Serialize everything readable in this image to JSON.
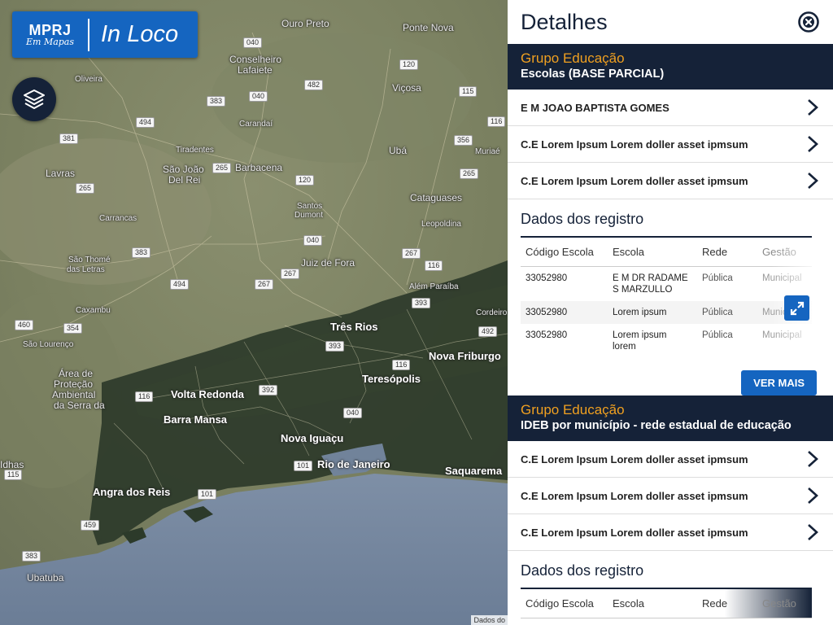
{
  "map": {
    "brand": {
      "mprj": "MPRJ",
      "subtitle": "Em Mapas",
      "product": "In Loco"
    },
    "layers_icon": "layers-icon",
    "attribution": "Dados do",
    "cities": [
      {
        "name": "Ouro Preto",
        "cls": ""
      },
      {
        "name": "Ponte Nova",
        "cls": ""
      },
      {
        "name": "Conselheiro",
        "cls": ""
      },
      {
        "name": "Lafaiete",
        "cls": ""
      },
      {
        "name": "Viçosa",
        "cls": ""
      },
      {
        "name": "Oliveira",
        "cls": "small"
      },
      {
        "name": "Carandaí",
        "cls": "small"
      },
      {
        "name": "Ubá",
        "cls": ""
      },
      {
        "name": "Muriaé",
        "cls": "small"
      },
      {
        "name": "Tiradentes",
        "cls": "small"
      },
      {
        "name": "São João",
        "cls": ""
      },
      {
        "name": "Del Rei",
        "cls": ""
      },
      {
        "name": "Barbacena",
        "cls": ""
      },
      {
        "name": "Lavras",
        "cls": ""
      },
      {
        "name": "Cataguases",
        "cls": ""
      },
      {
        "name": "Santos",
        "cls": "small"
      },
      {
        "name": "Dumont",
        "cls": "small"
      },
      {
        "name": "Carrancas",
        "cls": "small"
      },
      {
        "name": "Leopoldina",
        "cls": "small"
      },
      {
        "name": "Juiz de Fora",
        "cls": ""
      },
      {
        "name": "São Thomé",
        "cls": "small"
      },
      {
        "name": "das Letras",
        "cls": "small"
      },
      {
        "name": "Além Paraíba",
        "cls": "small"
      },
      {
        "name": "Caxambu",
        "cls": "small"
      },
      {
        "name": "Cordeiro",
        "cls": "small"
      },
      {
        "name": "São Lourenço",
        "cls": "small"
      },
      {
        "name": "Três Rios",
        "cls": "big"
      },
      {
        "name": "Nova Friburgo",
        "cls": "big"
      },
      {
        "name": "Teresópolis",
        "cls": "big"
      },
      {
        "name": "Área de",
        "cls": ""
      },
      {
        "name": "Proteção",
        "cls": ""
      },
      {
        "name": "Ambiental",
        "cls": ""
      },
      {
        "name": "da Serra da",
        "cls": ""
      },
      {
        "name": "Volta Redonda",
        "cls": "big"
      },
      {
        "name": "Barra Mansa",
        "cls": "big"
      },
      {
        "name": "Nova Iguaçu",
        "cls": "big"
      },
      {
        "name": "Rio de Janeiro",
        "cls": "big"
      },
      {
        "name": "Saquarema",
        "cls": "big"
      },
      {
        "name": "Angra dos Reis",
        "cls": "big"
      },
      {
        "name": "Ubatuba",
        "cls": ""
      },
      {
        "name": "Idhas",
        "cls": ""
      }
    ],
    "shields": [
      "040",
      "120",
      "482",
      "040",
      "383",
      "494",
      "116",
      "381",
      "356",
      "265",
      "265",
      "265",
      "120",
      "115",
      "383",
      "040",
      "267",
      "494",
      "267",
      "116",
      "267",
      "354",
      "460",
      "393",
      "492",
      "393",
      "116",
      "040",
      "392",
      "101",
      "101",
      "459",
      "383",
      "115",
      "116"
    ]
  },
  "panel": {
    "title": "Detalhes",
    "close_icon": "close-circle-icon",
    "groups": [
      {
        "name": "Grupo Educação",
        "layer": "Escolas (BASE PARCIAL)",
        "items": [
          "E M JOAO BAPTISTA GOMES",
          "C.E Lorem Ipsum Lorem doller asset ipmsum",
          "C.E Lorem Ipsum Lorem doller asset ipmsum"
        ],
        "records_title": "Dados dos registro",
        "columns": [
          "Código Escola",
          "Escola",
          "Rede",
          "Gestão"
        ],
        "rows": [
          [
            "33052980",
            "E M DR RADAME S MARZULLO",
            "Pública",
            "Municipal"
          ],
          [
            "33052980",
            "Lorem ipsum",
            "Pública",
            "Municipal"
          ],
          [
            "33052980",
            "Lorem ipsum lorem",
            "Pública",
            "Municipal"
          ]
        ],
        "more_label": "VER MAIS"
      },
      {
        "name": "Grupo Educação",
        "layer": "IDEB por município - rede estadual de educação",
        "items": [
          "C.E Lorem Ipsum Lorem doller asset ipmsum",
          "C.E Lorem Ipsum Lorem doller asset ipmsum",
          "C.E Lorem Ipsum Lorem doller asset ipmsum"
        ],
        "records_title": "Dados dos registro",
        "columns": [
          "Código Escola",
          "Escola",
          "Rede",
          "Gestão"
        ]
      }
    ]
  },
  "colors": {
    "navy": "#152238",
    "blue": "#1565c0",
    "orange": "#f0a020"
  }
}
